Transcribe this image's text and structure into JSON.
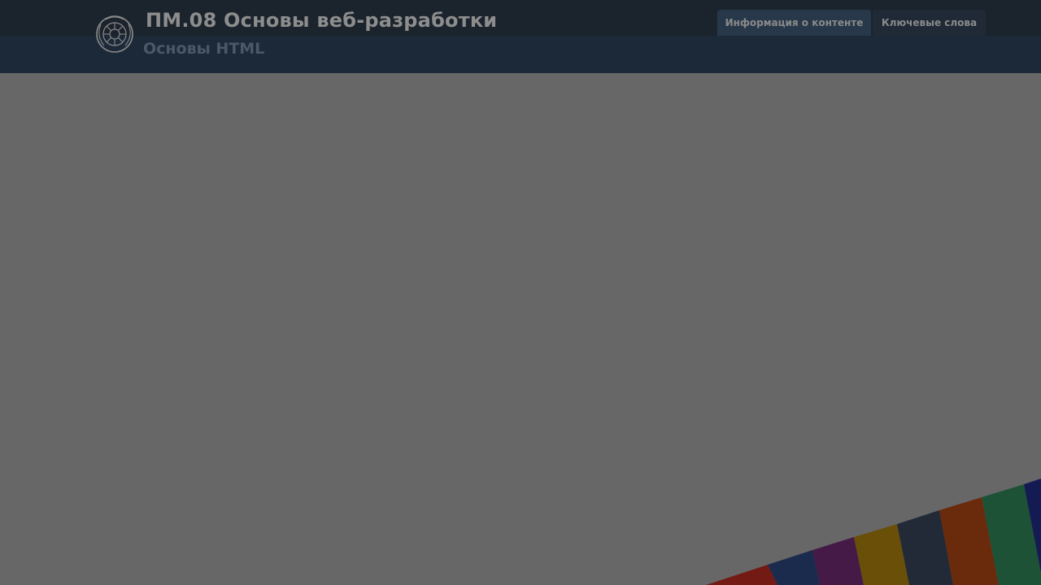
{
  "header": {
    "course_title": "ПМ.08 Основы веб-разработки",
    "module_title": "Основы HTML",
    "logo_icon": "course-logo-icon"
  },
  "tabs": [
    {
      "label": "Информация о контенте"
    },
    {
      "label": "Ключевые слова"
    }
  ],
  "colors": {
    "background": "#676767",
    "topbar": "#1b232d",
    "subbar": "#1c2938",
    "title_text": "#8d8d8d",
    "subtitle_text": "#4a5868",
    "tab_active": "#27384a",
    "tab_inactive": "#1f2a36",
    "stripe_colors": [
      "#741a14",
      "#1b2b4d",
      "#451a46",
      "#6a4f08",
      "#222a38",
      "#6a2a0c",
      "#1e5237",
      "#141a52"
    ]
  }
}
